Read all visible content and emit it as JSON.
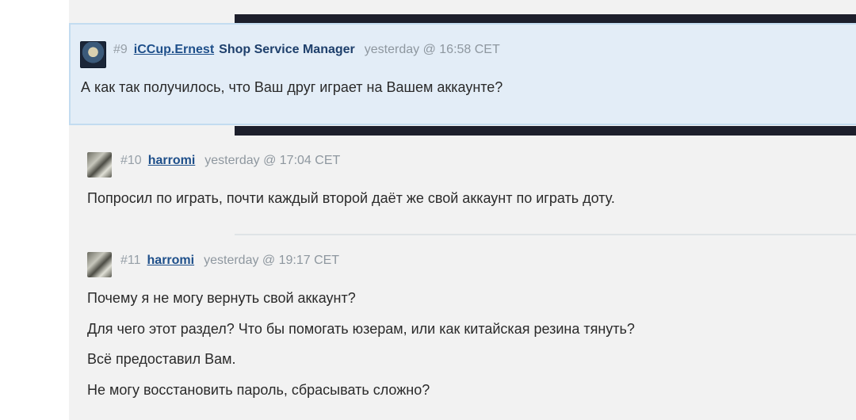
{
  "posts": [
    {
      "number": "#9",
      "author": "iCCup.Ernest",
      "role": "Shop Service Manager",
      "time": "yesterday @ 16:58 CET",
      "avatar": "ernest-avatar",
      "lines": [
        "А как так получилось, что Ваш друг играет на Вашем аккаунте?"
      ]
    },
    {
      "number": "#10",
      "author": "harromi",
      "time": "yesterday @ 17:04 CET",
      "avatar": "harromi-avatar",
      "lines": [
        "Попросил по играть, почти каждый второй даёт же свой аккаунт по играть доту."
      ]
    },
    {
      "number": "#11",
      "author": "harromi",
      "time": "yesterday @ 19:17 CET",
      "avatar": "harromi-avatar",
      "lines": [
        "Почему я не могу вернуть свой аккаунт?",
        "Для чего этот раздел? Что бы помогать юзерам, или как китайская резина тянуть?",
        "Всё предоставил Вам.",
        "Не могу восстановить пароль, сбрасывать сложно?"
      ]
    }
  ],
  "colors": {
    "highlight_bg": "#e3edf7",
    "highlight_border": "#c3dcf0",
    "author_link": "#1e4f8a",
    "dark_bar": "#1d1f2c",
    "thread_bg": "#f2f2f2"
  }
}
